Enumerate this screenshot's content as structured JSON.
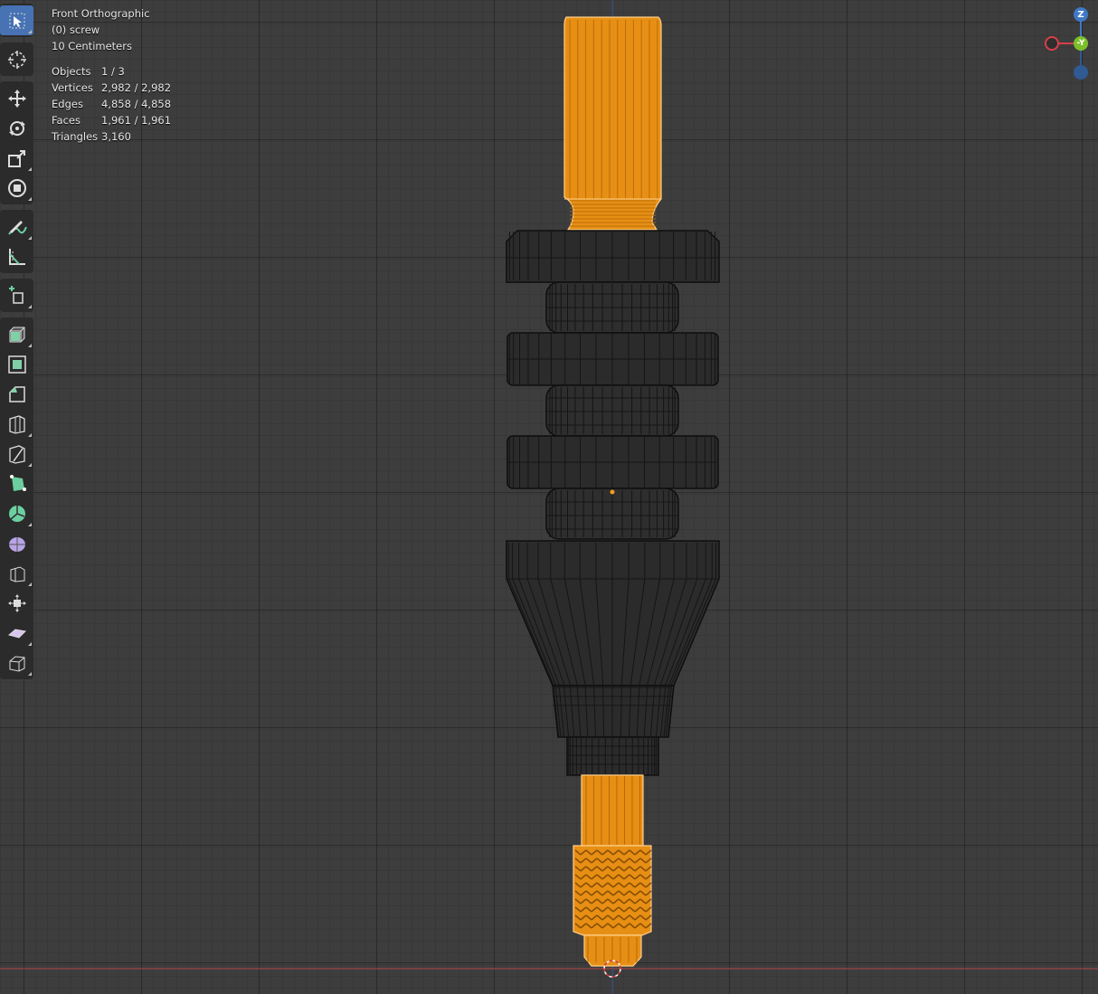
{
  "overlay": {
    "view_name": "Front Orthographic",
    "object_name": "(0) screw",
    "scale": "10 Centimeters",
    "stats": [
      {
        "label": "Objects",
        "value": "1 / 3"
      },
      {
        "label": "Vertices",
        "value": "2,982 / 2,982"
      },
      {
        "label": "Edges",
        "value": "4,858 / 4,858"
      },
      {
        "label": "Faces",
        "value": "1,961 / 1,961"
      },
      {
        "label": "Triangles",
        "value": "3,160"
      }
    ]
  },
  "gizmo": {
    "z_label": "Z",
    "y_label": "-Y",
    "x_color": "#d6404a",
    "y_color": "#7bbf2a",
    "z_color": "#3f78c7"
  },
  "toolbar": {
    "tools": [
      "select-box",
      "cursor",
      "move",
      "rotate",
      "scale",
      "transform",
      "annotate",
      "measure",
      "add-cube",
      "extrude",
      "inset",
      "bevel",
      "loop-cut",
      "knife",
      "poly-build",
      "spin",
      "smooth",
      "shrink-fatten",
      "shear",
      "shear-slide",
      "rip-region"
    ]
  },
  "colors": {
    "selected": "#f59b1c",
    "wire_selected": "#ffc96b",
    "mesh_dark": "#2b2b2b",
    "wire_dark": "#111111",
    "viewport_bg": "#3d3d3d"
  }
}
